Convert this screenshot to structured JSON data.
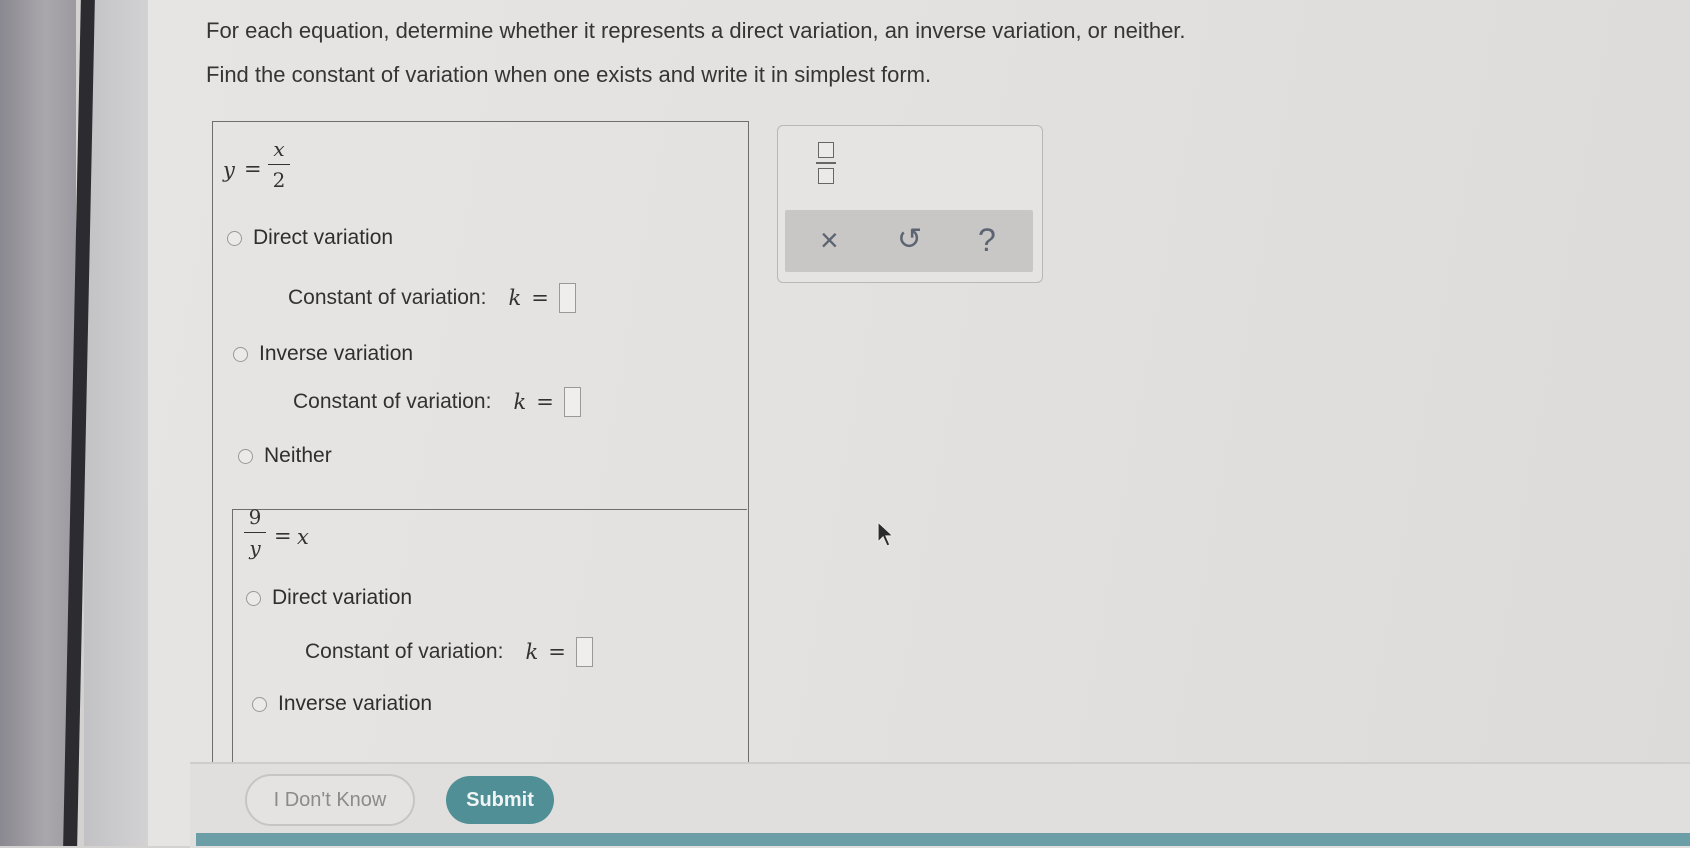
{
  "instructions": {
    "line1": "For each equation, determine whether it represents a direct variation, an inverse variation, or neither.",
    "line2": "Find the constant of variation when one exists and write it in simplest form."
  },
  "problems": [
    {
      "equation": {
        "lhs": "y",
        "eq": "=",
        "num": "x",
        "den": "2"
      },
      "options": {
        "direct": "Direct variation",
        "inverse": "Inverse variation",
        "neither": "Neither"
      },
      "constant_label": "Constant of variation:",
      "k": "k",
      "eq": "="
    },
    {
      "equation": {
        "num": "9",
        "den": "y",
        "eq": "=",
        "rhs": "x"
      },
      "options": {
        "direct": "Direct variation",
        "inverse": "Inverse variation"
      },
      "constant_label": "Constant of variation:",
      "k": "k",
      "eq": "="
    }
  ],
  "toolbar": {
    "clear": "×",
    "undo": "↺",
    "help": "?"
  },
  "footer": {
    "dont_know": "I Don't Know",
    "submit": "Submit"
  }
}
